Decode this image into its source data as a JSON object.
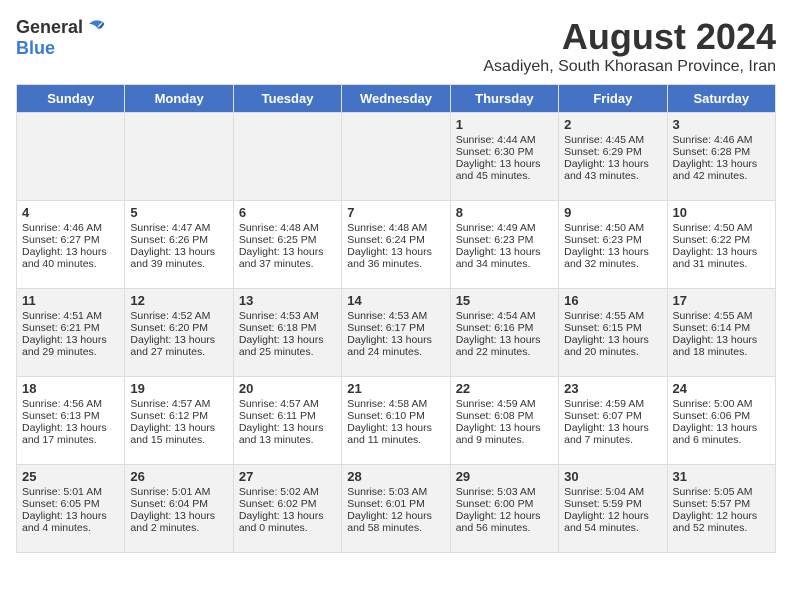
{
  "logo": {
    "general": "General",
    "blue": "Blue"
  },
  "title": "August 2024",
  "subtitle": "Asadiyeh, South Khorasan Province, Iran",
  "weekdays": [
    "Sunday",
    "Monday",
    "Tuesday",
    "Wednesday",
    "Thursday",
    "Friday",
    "Saturday"
  ],
  "weeks": [
    [
      {
        "day": "",
        "content": ""
      },
      {
        "day": "",
        "content": ""
      },
      {
        "day": "",
        "content": ""
      },
      {
        "day": "",
        "content": ""
      },
      {
        "day": "1",
        "content": "Sunrise: 4:44 AM\nSunset: 6:30 PM\nDaylight: 13 hours\nand 45 minutes."
      },
      {
        "day": "2",
        "content": "Sunrise: 4:45 AM\nSunset: 6:29 PM\nDaylight: 13 hours\nand 43 minutes."
      },
      {
        "day": "3",
        "content": "Sunrise: 4:46 AM\nSunset: 6:28 PM\nDaylight: 13 hours\nand 42 minutes."
      }
    ],
    [
      {
        "day": "4",
        "content": "Sunrise: 4:46 AM\nSunset: 6:27 PM\nDaylight: 13 hours\nand 40 minutes."
      },
      {
        "day": "5",
        "content": "Sunrise: 4:47 AM\nSunset: 6:26 PM\nDaylight: 13 hours\nand 39 minutes."
      },
      {
        "day": "6",
        "content": "Sunrise: 4:48 AM\nSunset: 6:25 PM\nDaylight: 13 hours\nand 37 minutes."
      },
      {
        "day": "7",
        "content": "Sunrise: 4:48 AM\nSunset: 6:24 PM\nDaylight: 13 hours\nand 36 minutes."
      },
      {
        "day": "8",
        "content": "Sunrise: 4:49 AM\nSunset: 6:23 PM\nDaylight: 13 hours\nand 34 minutes."
      },
      {
        "day": "9",
        "content": "Sunrise: 4:50 AM\nSunset: 6:23 PM\nDaylight: 13 hours\nand 32 minutes."
      },
      {
        "day": "10",
        "content": "Sunrise: 4:50 AM\nSunset: 6:22 PM\nDaylight: 13 hours\nand 31 minutes."
      }
    ],
    [
      {
        "day": "11",
        "content": "Sunrise: 4:51 AM\nSunset: 6:21 PM\nDaylight: 13 hours\nand 29 minutes."
      },
      {
        "day": "12",
        "content": "Sunrise: 4:52 AM\nSunset: 6:20 PM\nDaylight: 13 hours\nand 27 minutes."
      },
      {
        "day": "13",
        "content": "Sunrise: 4:53 AM\nSunset: 6:18 PM\nDaylight: 13 hours\nand 25 minutes."
      },
      {
        "day": "14",
        "content": "Sunrise: 4:53 AM\nSunset: 6:17 PM\nDaylight: 13 hours\nand 24 minutes."
      },
      {
        "day": "15",
        "content": "Sunrise: 4:54 AM\nSunset: 6:16 PM\nDaylight: 13 hours\nand 22 minutes."
      },
      {
        "day": "16",
        "content": "Sunrise: 4:55 AM\nSunset: 6:15 PM\nDaylight: 13 hours\nand 20 minutes."
      },
      {
        "day": "17",
        "content": "Sunrise: 4:55 AM\nSunset: 6:14 PM\nDaylight: 13 hours\nand 18 minutes."
      }
    ],
    [
      {
        "day": "18",
        "content": "Sunrise: 4:56 AM\nSunset: 6:13 PM\nDaylight: 13 hours\nand 17 minutes."
      },
      {
        "day": "19",
        "content": "Sunrise: 4:57 AM\nSunset: 6:12 PM\nDaylight: 13 hours\nand 15 minutes."
      },
      {
        "day": "20",
        "content": "Sunrise: 4:57 AM\nSunset: 6:11 PM\nDaylight: 13 hours\nand 13 minutes."
      },
      {
        "day": "21",
        "content": "Sunrise: 4:58 AM\nSunset: 6:10 PM\nDaylight: 13 hours\nand 11 minutes."
      },
      {
        "day": "22",
        "content": "Sunrise: 4:59 AM\nSunset: 6:08 PM\nDaylight: 13 hours\nand 9 minutes."
      },
      {
        "day": "23",
        "content": "Sunrise: 4:59 AM\nSunset: 6:07 PM\nDaylight: 13 hours\nand 7 minutes."
      },
      {
        "day": "24",
        "content": "Sunrise: 5:00 AM\nSunset: 6:06 PM\nDaylight: 13 hours\nand 6 minutes."
      }
    ],
    [
      {
        "day": "25",
        "content": "Sunrise: 5:01 AM\nSunset: 6:05 PM\nDaylight: 13 hours\nand 4 minutes."
      },
      {
        "day": "26",
        "content": "Sunrise: 5:01 AM\nSunset: 6:04 PM\nDaylight: 13 hours\nand 2 minutes."
      },
      {
        "day": "27",
        "content": "Sunrise: 5:02 AM\nSunset: 6:02 PM\nDaylight: 13 hours\nand 0 minutes."
      },
      {
        "day": "28",
        "content": "Sunrise: 5:03 AM\nSunset: 6:01 PM\nDaylight: 12 hours\nand 58 minutes."
      },
      {
        "day": "29",
        "content": "Sunrise: 5:03 AM\nSunset: 6:00 PM\nDaylight: 12 hours\nand 56 minutes."
      },
      {
        "day": "30",
        "content": "Sunrise: 5:04 AM\nSunset: 5:59 PM\nDaylight: 12 hours\nand 54 minutes."
      },
      {
        "day": "31",
        "content": "Sunrise: 5:05 AM\nSunset: 5:57 PM\nDaylight: 12 hours\nand 52 minutes."
      }
    ]
  ]
}
